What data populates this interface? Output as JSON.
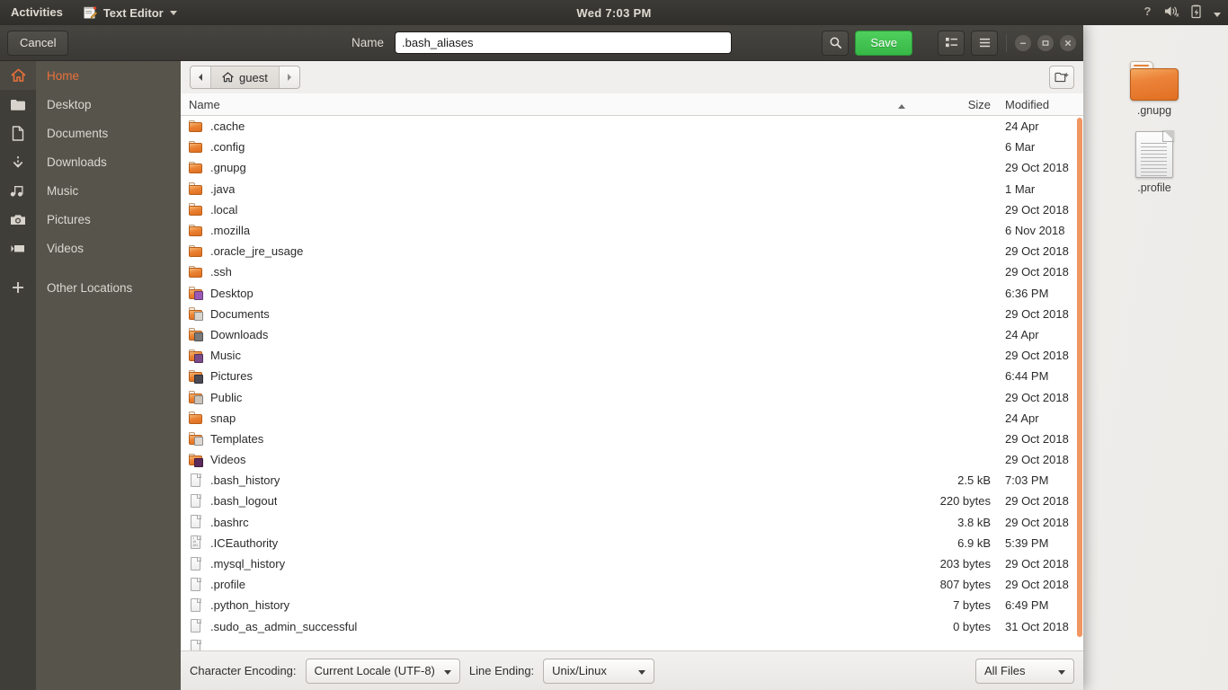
{
  "topbar": {
    "activities": "Activities",
    "app_name": "Text Editor",
    "app_icon": "text-editor-icon",
    "clock": "Wed  7:03 PM",
    "indicators": [
      "help-icon",
      "volume-muted-icon",
      "battery-icon",
      "system-menu-chevron-icon"
    ]
  },
  "dialog": {
    "cancel_label": "Cancel",
    "name_label": "Name",
    "name_value": ".bash_aliases",
    "name_placeholder": "",
    "save_label": "Save",
    "search_icon": "search-icon",
    "view_icon": "list-view-icon",
    "menu_icon": "hamburger-menu-icon",
    "accent_green": "#3bbd4c",
    "window_controls": [
      "minimize-icon",
      "maximize-icon",
      "close-icon"
    ]
  },
  "sidebar": {
    "items": [
      {
        "label": "Home",
        "icon": "home-icon",
        "selected": true
      },
      {
        "label": "Desktop",
        "icon": "folder-icon",
        "selected": false
      },
      {
        "label": "Documents",
        "icon": "document-icon",
        "selected": false
      },
      {
        "label": "Downloads",
        "icon": "download-icon",
        "selected": false
      },
      {
        "label": "Music",
        "icon": "music-note-icon",
        "selected": false
      },
      {
        "label": "Pictures",
        "icon": "camera-icon",
        "selected": false
      },
      {
        "label": "Videos",
        "icon": "video-camera-icon",
        "selected": false
      },
      {
        "label": "Other Locations",
        "icon": "plus-icon",
        "selected": false
      }
    ]
  },
  "pathbar": {
    "back_icon": "chevron-left-icon",
    "forward_icon": "chevron-right-icon",
    "crumb_icon": "home-icon",
    "crumb_label": "guest",
    "new_folder_icon": "new-folder-icon"
  },
  "filelist": {
    "columns": {
      "name": "Name",
      "size": "Size",
      "modified": "Modified"
    },
    "sort_column": "Name",
    "sort_direction": "ascending",
    "rows": [
      {
        "name": ".cache",
        "size": "",
        "modified": "24 Apr",
        "kind": "folder",
        "emblem": ""
      },
      {
        "name": ".config",
        "size": "",
        "modified": "6 Mar",
        "kind": "folder",
        "emblem": ""
      },
      {
        "name": ".gnupg",
        "size": "",
        "modified": "29 Oct 2018",
        "kind": "folder",
        "emblem": ""
      },
      {
        "name": ".java",
        "size": "",
        "modified": "1 Mar",
        "kind": "folder",
        "emblem": ""
      },
      {
        "name": ".local",
        "size": "",
        "modified": "29 Oct 2018",
        "kind": "folder",
        "emblem": ""
      },
      {
        "name": ".mozilla",
        "size": "",
        "modified": "6 Nov 2018",
        "kind": "folder",
        "emblem": ""
      },
      {
        "name": ".oracle_jre_usage",
        "size": "",
        "modified": "29 Oct 2018",
        "kind": "folder",
        "emblem": ""
      },
      {
        "name": ".ssh",
        "size": "",
        "modified": "29 Oct 2018",
        "kind": "folder",
        "emblem": ""
      },
      {
        "name": "Desktop",
        "size": "",
        "modified": "6:36 PM",
        "kind": "folder",
        "emblem": "#9b59b6"
      },
      {
        "name": "Documents",
        "size": "",
        "modified": "29 Oct 2018",
        "kind": "folder",
        "emblem": "#d8d4cd"
      },
      {
        "name": "Downloads",
        "size": "",
        "modified": "24 Apr",
        "kind": "folder",
        "emblem": "#7a7a7a"
      },
      {
        "name": "Music",
        "size": "",
        "modified": "29 Oct 2018",
        "kind": "folder",
        "emblem": "#7b4b8a"
      },
      {
        "name": "Pictures",
        "size": "",
        "modified": "6:44 PM",
        "kind": "folder",
        "emblem": "#4a4a55"
      },
      {
        "name": "Public",
        "size": "",
        "modified": "29 Oct 2018",
        "kind": "folder",
        "emblem": "#c9c3ba"
      },
      {
        "name": "snap",
        "size": "",
        "modified": "24 Apr",
        "kind": "folder",
        "emblem": ""
      },
      {
        "name": "Templates",
        "size": "",
        "modified": "29 Oct 2018",
        "kind": "folder",
        "emblem": "#dcd8d1"
      },
      {
        "name": "Videos",
        "size": "",
        "modified": "29 Oct 2018",
        "kind": "folder",
        "emblem": "#5c2a5c"
      },
      {
        "name": ".bash_history",
        "size": "2.5 kB",
        "modified": "7:03 PM",
        "kind": "file",
        "emblem": ""
      },
      {
        "name": ".bash_logout",
        "size": "220 bytes",
        "modified": "29 Oct 2018",
        "kind": "file",
        "emblem": ""
      },
      {
        "name": ".bashrc",
        "size": "3.8 kB",
        "modified": "29 Oct 2018",
        "kind": "file",
        "emblem": ""
      },
      {
        "name": ".ICEauthority",
        "size": "6.9 kB",
        "modified": "5:39 PM",
        "kind": "binary",
        "emblem": ""
      },
      {
        "name": ".mysql_history",
        "size": "203 bytes",
        "modified": "29 Oct 2018",
        "kind": "file",
        "emblem": ""
      },
      {
        "name": ".profile",
        "size": "807 bytes",
        "modified": "29 Oct 2018",
        "kind": "file",
        "emblem": ""
      },
      {
        "name": ".python_history",
        "size": "7 bytes",
        "modified": "6:49 PM",
        "kind": "file",
        "emblem": ""
      },
      {
        "name": ".sudo_as_admin_successful",
        "size": "0 bytes",
        "modified": "31 Oct 2018",
        "kind": "file",
        "emblem": ""
      },
      {
        "name": "",
        "size": "",
        "modified": "",
        "kind": "file",
        "emblem": ""
      }
    ]
  },
  "footer": {
    "encoding_label": "Character Encoding:",
    "encoding_value": "Current Locale (UTF-8)",
    "line_ending_label": "Line Ending:",
    "line_ending_value": "Unix/Linux",
    "filter_value": "All Files"
  },
  "desktop": {
    "icons": [
      {
        "label": ".gnupg",
        "kind": "folder"
      },
      {
        "label": ".profile",
        "kind": "document"
      }
    ]
  }
}
